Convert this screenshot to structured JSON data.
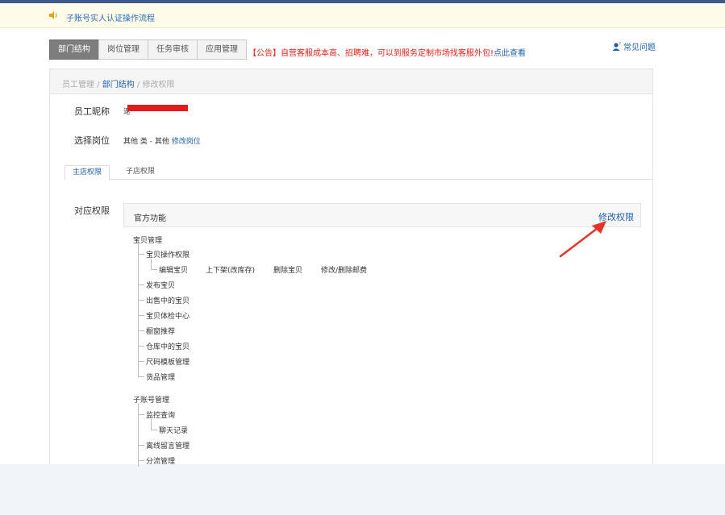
{
  "notice": {
    "text": "子账号实人认证操作流程"
  },
  "top_tabs": [
    {
      "label": "部门结构",
      "active": true
    },
    {
      "label": "岗位管理",
      "active": false
    },
    {
      "label": "任务审核",
      "active": false
    },
    {
      "label": "应用管理",
      "active": false
    }
  ],
  "announcement": {
    "text": "【公告】自营客服成本高、招聘难，可以到服务定制市场找客服外包!",
    "link": "点此查看"
  },
  "faq": {
    "label": "常见问题"
  },
  "breadcrumb": {
    "part1": "员工管理",
    "sep1": " / ",
    "part2": "部门结构",
    "sep2": " / ",
    "part3": "修改权限"
  },
  "employee": {
    "nickname_label": "员工昵称",
    "nickname_prefix": "速",
    "position_label": "选择岗位",
    "position_value": "其他 类 - 其他",
    "position_edit": "修改岗位"
  },
  "sub_tabs": [
    {
      "label": "主店权限",
      "active": true
    },
    {
      "label": "子店权限",
      "active": false
    }
  ],
  "permissions": {
    "label": "对应权限",
    "box_title": "官方功能",
    "edit_link": "修改权限",
    "group1": {
      "title": "宝贝管理",
      "ops_title": "宝贝操作权限",
      "ops": [
        "编辑宝贝",
        "上下架(改库存)",
        "删除宝贝",
        "修改/删除邮费"
      ],
      "items": [
        "发布宝贝",
        "出售中的宝贝",
        "宝贝体检中心",
        "橱窗推荐",
        "仓库中的宝贝",
        "尺码模板管理",
        "货品管理"
      ]
    },
    "group2": {
      "title": "子账号管理",
      "monitor_title": "监控查询",
      "monitor_child": "聊天记录",
      "items": [
        "离线留言管理",
        "分流管理"
      ]
    }
  },
  "colors": {
    "link": "#1f5fa8",
    "alert": "#e0201a",
    "redaction": "#e41b1b"
  }
}
